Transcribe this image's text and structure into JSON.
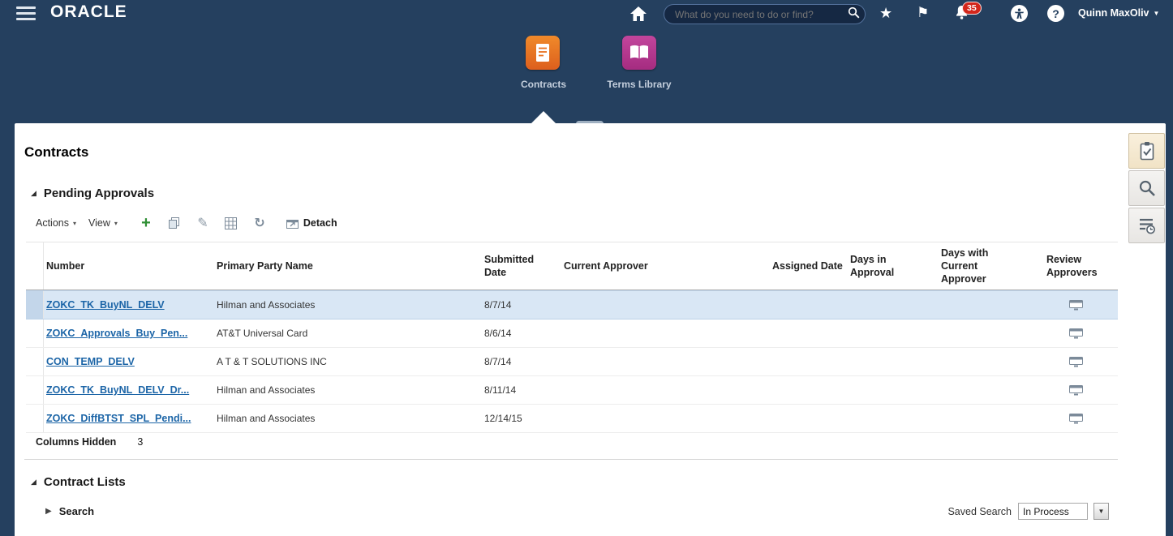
{
  "header": {
    "logo": "ORACLE",
    "search_placeholder": "What do you need to do or find?",
    "notification_count": "35",
    "user_name": "Quinn MaxOliv"
  },
  "springboard": {
    "apps": [
      {
        "label": "Contracts"
      },
      {
        "label": "Terms Library"
      }
    ]
  },
  "page": {
    "title": "Contracts"
  },
  "sections": {
    "pending_approvals": {
      "title": "Pending Approvals"
    },
    "contract_lists": {
      "title": "Contract Lists"
    }
  },
  "toolbar": {
    "actions_label": "Actions",
    "view_label": "View",
    "detach_label": "Detach"
  },
  "table": {
    "columns": [
      "Number",
      "Primary Party Name",
      "Submitted Date",
      "Current Approver",
      "Assigned Date",
      "Days in Approval",
      "Days with Current Approver",
      "Review Approvers"
    ],
    "rows": [
      {
        "number": "ZOKC_TK_BuyNL_DELV",
        "party": "Hilman and Associates",
        "submitted": "8/7/14"
      },
      {
        "number": "ZOKC_Approvals_Buy_Pen...",
        "party": "AT&T Universal Card",
        "submitted": "8/6/14"
      },
      {
        "number": "CON_TEMP_DELV",
        "party": "A T & T SOLUTIONS INC",
        "submitted": "8/7/14"
      },
      {
        "number": "ZOKC_TK_BuyNL_DELV_Dr...",
        "party": "Hilman and Associates",
        "submitted": "8/11/14"
      },
      {
        "number": "ZOKC_DiffBTST_SPL_Pendi...",
        "party": "Hilman and Associates",
        "submitted": "12/14/15"
      }
    ],
    "footer": {
      "columns_hidden_label": "Columns Hidden",
      "columns_hidden_count": "3"
    }
  },
  "contract_lists": {
    "search_label": "Search",
    "saved_search_label": "Saved Search",
    "saved_search_value": "In Process"
  },
  "icons": {
    "star": "★",
    "flag": "⚑",
    "help": "?",
    "caret_down": "▼",
    "menu_caret": "▾",
    "section_expanded": "◢",
    "section_collapsed": "▶",
    "refresh": "↻",
    "add": "+",
    "edit_pencil": "✎",
    "dropdown_arrow": "▼"
  },
  "colors": {
    "header_background": "#25405f",
    "link": "#1c65a7",
    "selected_row": "#d9e7f5",
    "contracts_tile": "#e8711f",
    "terms_library_tile": "#b5368f",
    "notification_badge": "#d3271c"
  }
}
